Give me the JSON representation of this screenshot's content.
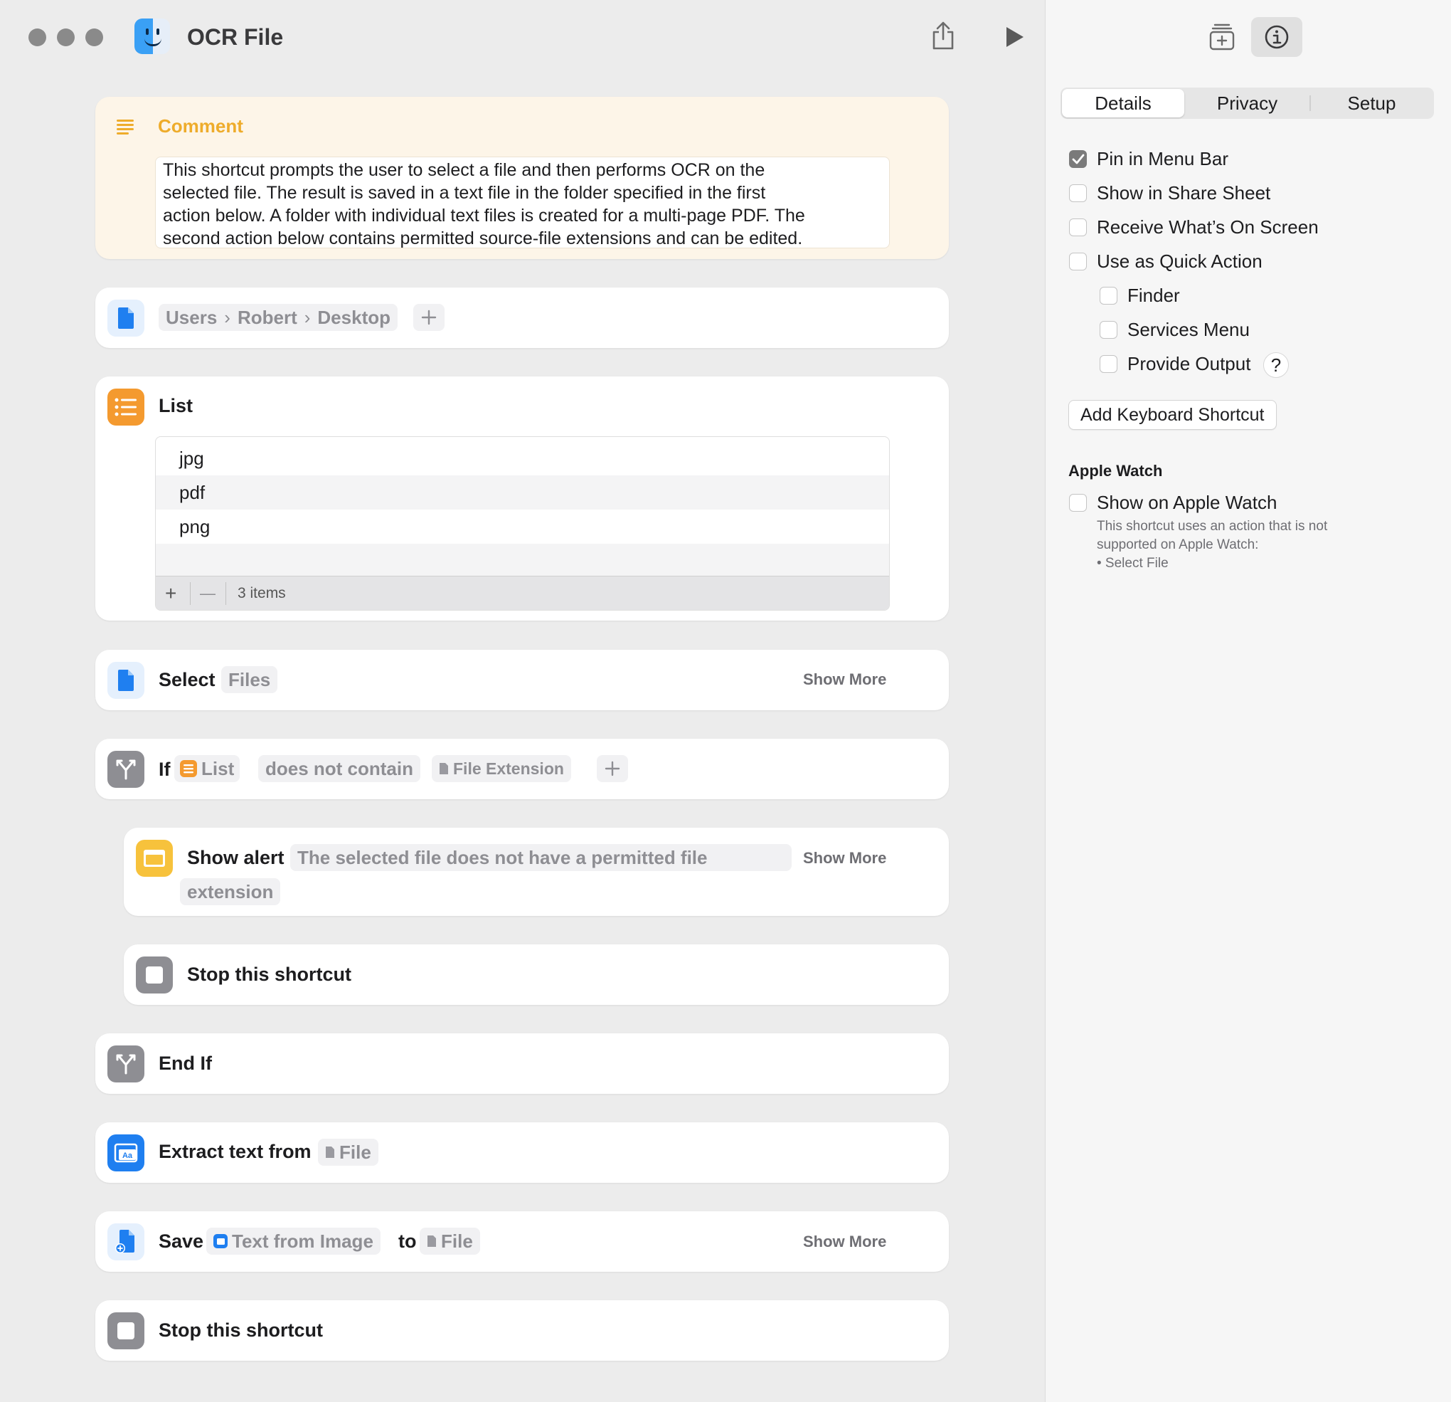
{
  "window": {
    "title": "OCR File"
  },
  "comment": {
    "heading": "Comment",
    "lines": [
      "This shortcut prompts the user to select a file and then performs OCR on the",
      "selected file. The result is saved in a text file in the folder specified in the first",
      "action below. A folder with individual text files is created for a multi-page PDF. The",
      "second action below contains permitted source-file extensions and can be edited."
    ]
  },
  "folder_action": {
    "path": [
      "Users",
      "Robert",
      "Desktop"
    ],
    "separator": "›"
  },
  "list_action": {
    "label": "List",
    "items": [
      "jpg",
      "pdf",
      "png"
    ],
    "count_text": "3 items",
    "add_symbol": "+",
    "remove_symbol": "—"
  },
  "select_action": {
    "label": "Select",
    "token": "Files",
    "show_more": "Show More"
  },
  "if_action": {
    "label": "If",
    "token_list": "List",
    "condition": "does not contain",
    "token_ext": "File Extension"
  },
  "alert_action": {
    "label": "Show alert",
    "text_line1": "The selected file does not have a permitted file",
    "text_line2": "extension",
    "show_more": "Show More"
  },
  "stop_action_1": {
    "label": "Stop this shortcut"
  },
  "endif_action": {
    "label": "End If"
  },
  "extract_action": {
    "label": "Extract text from",
    "token": "File"
  },
  "save_action": {
    "label": "Save",
    "token_text": "Text from Image",
    "to": "to",
    "token_file": "File",
    "show_more": "Show More"
  },
  "stop_action_2": {
    "label": "Stop this shortcut"
  },
  "sidebar": {
    "tabs": [
      "Details",
      "Privacy",
      "Setup"
    ],
    "active_tab": "Details",
    "checkboxes": [
      {
        "label": "Pin in Menu Bar",
        "checked": true
      },
      {
        "label": "Show in Share Sheet",
        "checked": false
      },
      {
        "label": "Receive What’s On Screen",
        "checked": false
      },
      {
        "label": "Use as Quick Action",
        "checked": false
      },
      {
        "label": "Finder",
        "checked": false
      },
      {
        "label": "Services Menu",
        "checked": false
      },
      {
        "label": "Provide Output",
        "checked": false
      }
    ],
    "help_symbol": "?",
    "keyboard_button": "Add Keyboard Shortcut",
    "watch_section": {
      "title": "Apple Watch",
      "checkbox": {
        "label": "Show on Apple Watch",
        "checked": false
      },
      "note_lines": [
        "This shortcut uses an action that is not",
        "supported on Apple Watch:",
        "• Select File"
      ]
    }
  },
  "colors": {
    "comment_accent": "#eeac2b",
    "list_icon": "#f49a2f",
    "action_blue": "#1f7ff0",
    "alert_yellow": "#f7c23c",
    "control_gray": "#8e8e93"
  }
}
